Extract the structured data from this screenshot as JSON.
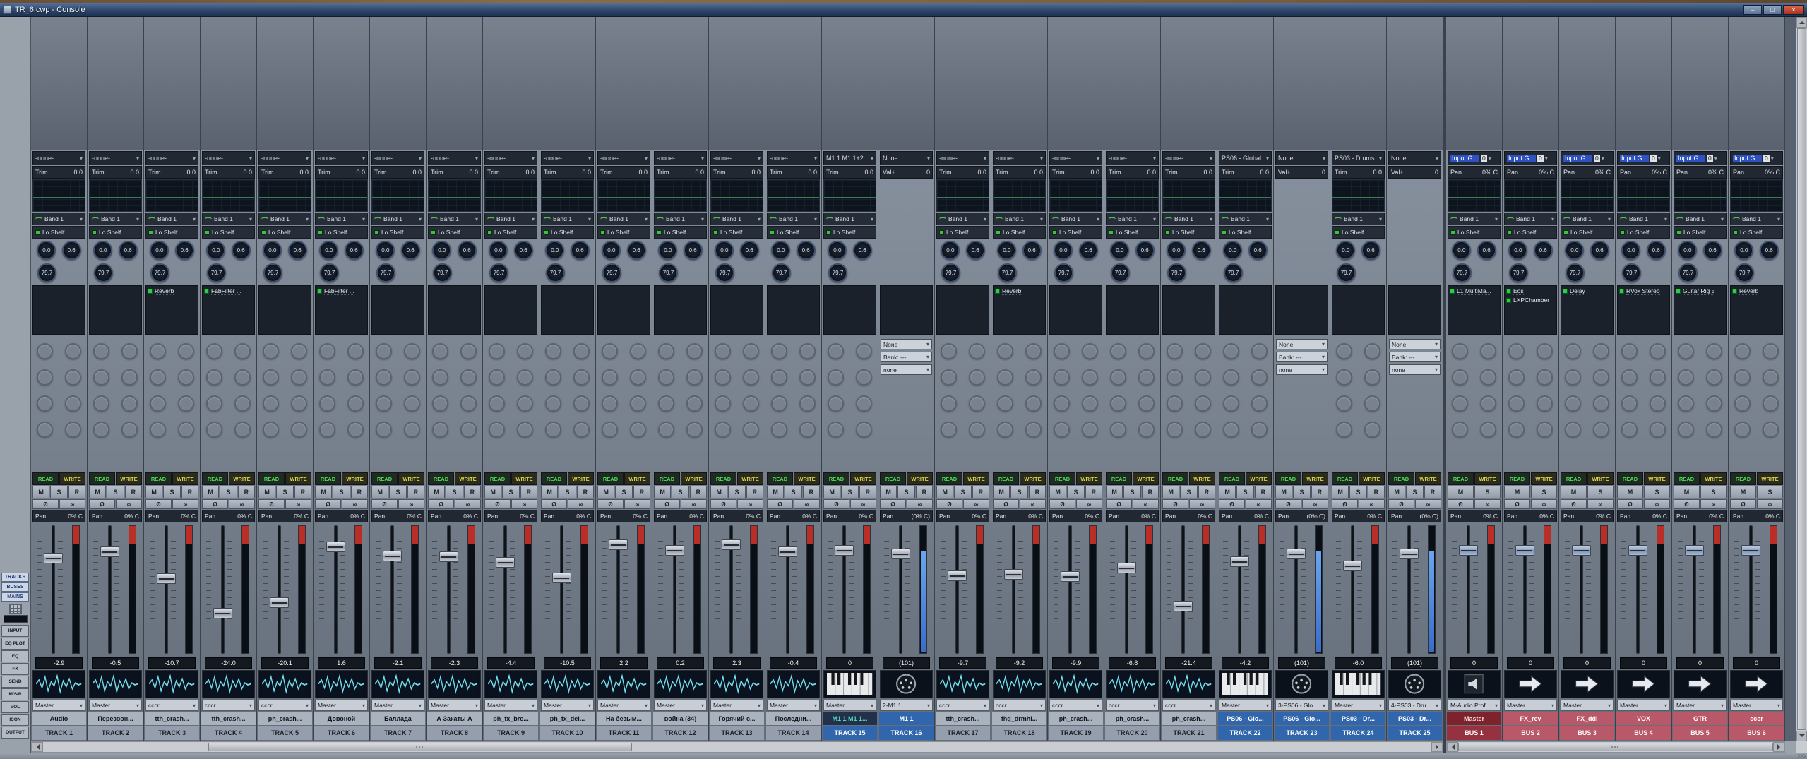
{
  "window": {
    "title": "TR_6.cwp - Console",
    "minimize": "–",
    "maximize": "□",
    "close": "×"
  },
  "glyphs": {
    "dropdown": "▾"
  },
  "left_toolbar": {
    "view_toggles": [
      "TRACKS",
      "BUSES",
      "MAINS"
    ],
    "widget_toggles": [
      "INPUT",
      "EQ PLOT",
      "EQ",
      "FX",
      "SEND",
      "M/S/R",
      "VOL",
      "ICON",
      "OUTPUT"
    ]
  },
  "strip_defaults": {
    "eq": {
      "band": "Band 1",
      "filter": "Lo Shelf",
      "gain": "0.0",
      "q": "0.6",
      "freq": "79.7"
    },
    "automation": {
      "read": "READ",
      "write": "WRITE"
    },
    "track_buttons": [
      "M",
      "S",
      "R"
    ],
    "bus_buttons": [
      "M",
      "S"
    ],
    "misc_buttons": [
      "Ø",
      "∞"
    ]
  },
  "colors": {
    "name_bg": "#aab2be",
    "name_fg": "#12161c",
    "label_bg": "#959eac",
    "label_fg": "#1a1f26",
    "selected_bg": "#3166ac",
    "selected_fg": "#ffffff",
    "meter_clip_red": "#b92f28",
    "midi_meter_blue": "#4a88e0",
    "fx_led_green": "#2fcb4a",
    "read_green": "#4ade52",
    "write_yellow": "#d9d44c"
  },
  "tracks": [
    {
      "name": "Audio",
      "label": "TRACK 1",
      "kind": "audio",
      "icon": "waveform",
      "input": "-none-",
      "gain_label": "Trim",
      "gain_value": "0.0",
      "pan_label": "Pan",
      "pan_value": "0% C",
      "fader": "-2.9",
      "output": "Master",
      "fx": []
    },
    {
      "name": "Перезвон...",
      "label": "TRACK 2",
      "kind": "audio",
      "icon": "waveform",
      "input": "-none-",
      "gain_label": "Trim",
      "gain_value": "0.0",
      "pan_label": "Pan",
      "pan_value": "0% C",
      "fader": "-0.5",
      "output": "Master",
      "fx": []
    },
    {
      "name": "tth_crash...",
      "label": "TRACK 3",
      "kind": "audio",
      "icon": "waveform",
      "input": "-none-",
      "gain_label": "Trim",
      "gain_value": "0.0",
      "pan_label": "Pan",
      "pan_value": "0% C",
      "fader": "-10.7",
      "output": "cccr",
      "fx": [
        "Reverb"
      ]
    },
    {
      "name": "tth_crash...",
      "label": "TRACK 4",
      "kind": "audio",
      "icon": "waveform",
      "input": "-none-",
      "gain_label": "Trim",
      "gain_value": "0.0",
      "pan_label": "Pan",
      "pan_value": "0% C",
      "fader": "-24.0",
      "output": "cccr",
      "fx": [
        "FabFilter ..."
      ]
    },
    {
      "name": "ph_crash...",
      "label": "TRACK 5",
      "kind": "audio",
      "icon": "waveform",
      "input": "-none-",
      "gain_label": "Trim",
      "gain_value": "0.0",
      "pan_label": "Pan",
      "pan_value": "0% C",
      "fader": "-20.1",
      "output": "cccr",
      "fx": []
    },
    {
      "name": "Довоной",
      "label": "TRACK 6",
      "kind": "audio",
      "icon": "waveform",
      "input": "-none-",
      "gain_label": "Trim",
      "gain_value": "0.0",
      "pan_label": "Pan",
      "pan_value": "0% C",
      "fader": "1.6",
      "output": "Master",
      "fx": [
        "FabFilter ..."
      ]
    },
    {
      "name": "Баллада",
      "label": "TRACK 7",
      "kind": "audio",
      "icon": "waveform",
      "input": "-none-",
      "gain_label": "Trim",
      "gain_value": "0.0",
      "pan_label": "Pan",
      "pan_value": "0% C",
      "fader": "-2.1",
      "output": "Master",
      "fx": []
    },
    {
      "name": "А Закаты А",
      "label": "TRACK 8",
      "kind": "audio",
      "icon": "waveform",
      "input": "-none-",
      "gain_label": "Trim",
      "gain_value": "0.0",
      "pan_label": "Pan",
      "pan_value": "0% C",
      "fader": "-2.3",
      "output": "Master",
      "fx": []
    },
    {
      "name": "ph_fx_bre...",
      "label": "TRACK 9",
      "kind": "audio",
      "icon": "waveform",
      "input": "-none-",
      "gain_label": "Trim",
      "gain_value": "0.0",
      "pan_label": "Pan",
      "pan_value": "0% C",
      "fader": "-4.4",
      "output": "Master",
      "fx": []
    },
    {
      "name": "ph_fx_del...",
      "label": "TRACK 10",
      "kind": "audio",
      "icon": "waveform",
      "input": "-none-",
      "gain_label": "Trim",
      "gain_value": "0.0",
      "pan_label": "Pan",
      "pan_value": "0% C",
      "fader": "-10.5",
      "output": "Master",
      "fx": []
    },
    {
      "name": "На безым...",
      "label": "TRACK 11",
      "kind": "audio",
      "icon": "waveform",
      "input": "-none-",
      "gain_label": "Trim",
      "gain_value": "0.0",
      "pan_label": "Pan",
      "pan_value": "0% C",
      "fader": "2.2",
      "output": "Master",
      "fx": []
    },
    {
      "name": "война (34)",
      "label": "TRACK 12",
      "kind": "audio",
      "icon": "waveform",
      "input": "-none-",
      "gain_label": "Trim",
      "gain_value": "0.0",
      "pan_label": "Pan",
      "pan_value": "0% C",
      "fader": "0.2",
      "output": "Master",
      "fx": []
    },
    {
      "name": "Горячий с...",
      "label": "TRACK 13",
      "kind": "audio",
      "icon": "waveform",
      "input": "-none-",
      "gain_label": "Trim",
      "gain_value": "0.0",
      "pan_label": "Pan",
      "pan_value": "0% C",
      "fader": "2.3",
      "output": "Master",
      "fx": []
    },
    {
      "name": "Последни...",
      "label": "TRACK 14",
      "kind": "audio",
      "icon": "waveform",
      "input": "-none-",
      "gain_label": "Trim",
      "gain_value": "0.0",
      "pan_label": "Pan",
      "pan_value": "0% C",
      "fader": "-0.4",
      "output": "Master",
      "fx": []
    },
    {
      "name": "M1 1 M1 1...",
      "label": "TRACK 15",
      "kind": "synth",
      "icon": "keyboard",
      "input": "M1 1 M1 1+2",
      "gain_label": "Trim",
      "gain_value": "0.0",
      "pan_label": "Pan",
      "pan_value": "0% C",
      "fader": "0",
      "output": "Master",
      "fx": [],
      "selected": true,
      "name_bg": "#22304a",
      "name_fg": "#4fd8c4"
    },
    {
      "name": "M1 1",
      "label": "TRACK 16",
      "kind": "midi",
      "icon": "midi-din",
      "input": "None",
      "gain_label": "Val+",
      "gain_value": "0",
      "pan_label": "Pan",
      "pan_value": "(0% C)",
      "fader": "(101)",
      "output": "2-M1 1",
      "fx": [],
      "widgets": [
        "None",
        "Bank: ---",
        "none"
      ],
      "selected": true
    },
    {
      "name": "tth_crash...",
      "label": "TRACK 17",
      "kind": "audio",
      "icon": "waveform",
      "input": "-none-",
      "gain_label": "Trim",
      "gain_value": "0.0",
      "pan_label": "Pan",
      "pan_value": "0% C",
      "fader": "-9.7",
      "output": "cccr",
      "fx": []
    },
    {
      "name": "fhg_drmhi...",
      "label": "TRACK 18",
      "kind": "audio",
      "icon": "waveform",
      "input": "-none-",
      "gain_label": "Trim",
      "gain_value": "0.0",
      "pan_label": "Pan",
      "pan_value": "0% C",
      "fader": "-9.2",
      "output": "cccr",
      "fx": [
        "Reverb"
      ]
    },
    {
      "name": "ph_crash...",
      "label": "TRACK 19",
      "kind": "audio",
      "icon": "waveform",
      "input": "-none-",
      "gain_label": "Trim",
      "gain_value": "0.0",
      "pan_label": "Pan",
      "pan_value": "0% C",
      "fader": "-9.9",
      "output": "cccr",
      "fx": []
    },
    {
      "name": "ph_crash...",
      "label": "TRACK 20",
      "kind": "audio",
      "icon": "waveform",
      "input": "-none-",
      "gain_label": "Trim",
      "gain_value": "0.0",
      "pan_label": "Pan",
      "pan_value": "0% C",
      "fader": "-6.8",
      "output": "cccr",
      "fx": []
    },
    {
      "name": "ph_crash...",
      "label": "TRACK 21",
      "kind": "audio",
      "icon": "waveform",
      "input": "-none-",
      "gain_label": "Trim",
      "gain_value": "0.0",
      "pan_label": "Pan",
      "pan_value": "0% C",
      "fader": "-21.4",
      "output": "cccr",
      "fx": []
    },
    {
      "name": "PS06 - Glo...",
      "label": "TRACK 22",
      "kind": "synth",
      "icon": "keyboard",
      "input": "PS06 - Global",
      "gain_label": "Trim",
      "gain_value": "0.0",
      "pan_label": "Pan",
      "pan_value": "0% C",
      "fader": "-4.2",
      "output": "Master",
      "fx": [],
      "selected": true
    },
    {
      "name": "PS06 - Glo...",
      "label": "TRACK 23",
      "kind": "midi",
      "icon": "midi-din",
      "input": "None",
      "gain_label": "Val+",
      "gain_value": "0",
      "pan_label": "Pan",
      "pan_value": "(0% C)",
      "fader": "(101)",
      "output": "3-PS06 - Glo",
      "fx": [],
      "widgets": [
        "None",
        "Bank: ---",
        "none"
      ],
      "selected": true
    },
    {
      "name": "PS03 - Dr...",
      "label": "TRACK 24",
      "kind": "synth",
      "icon": "keyboard",
      "input": "PS03 - Drums",
      "gain_label": "Trim",
      "gain_value": "0.0",
      "pan_label": "Pan",
      "pan_value": "0% C",
      "fader": "-6.0",
      "output": "Master",
      "fx": [],
      "selected": true
    },
    {
      "name": "PS03 - Dr...",
      "label": "TRACK 25",
      "kind": "midi",
      "icon": "midi-din",
      "input": "None",
      "gain_label": "Val+",
      "gain_value": "0",
      "pan_label": "Pan",
      "pan_value": "(0% C)",
      "fader": "(101)",
      "output": "4-PS03 - Dru",
      "fx": [],
      "widgets": [
        "None",
        "Bank: ---",
        "none"
      ],
      "selected": true
    }
  ],
  "buses": [
    {
      "name": "Master",
      "label": "BUS 1",
      "kind": "bus",
      "icon": "speaker",
      "input": "Input G...",
      "input_value": "0",
      "gain_label": "Pan",
      "gain_value": "0% C",
      "pan_label": "Pan",
      "pan_value": "0% C",
      "fader": "0",
      "output": "M-Audio Prof",
      "fx": [
        "L1 MultiMa..."
      ],
      "name_bg": "#7e222c",
      "name_fg": "#f2d8da",
      "label_bg": "#963240",
      "label_fg": "#ffffff"
    },
    {
      "name": "FX_rev",
      "label": "BUS 2",
      "kind": "bus",
      "icon": "arrow",
      "input": "Input G...",
      "input_value": "0",
      "gain_label": "Pan",
      "gain_value": "0% C",
      "pan_label": "Pan",
      "pan_value": "0% C",
      "fader": "0",
      "output": "Master",
      "fx": [
        "Eos",
        "LXPChamber"
      ],
      "name_bg": "#b85868",
      "name_fg": "#ffffff",
      "label_bg": "#b85868",
      "label_fg": "#ffffff"
    },
    {
      "name": "FX_ddl",
      "label": "BUS 3",
      "kind": "bus",
      "icon": "arrow",
      "input": "Input G...",
      "input_value": "0",
      "gain_label": "Pan",
      "gain_value": "0% C",
      "pan_label": "Pan",
      "pan_value": "0% C",
      "fader": "0",
      "output": "Master",
      "fx": [
        "Delay"
      ],
      "name_bg": "#b85868",
      "name_fg": "#ffffff",
      "label_bg": "#b85868",
      "label_fg": "#ffffff"
    },
    {
      "name": "VOX",
      "label": "BUS 4",
      "kind": "bus",
      "icon": "arrow",
      "input": "Input G...",
      "input_value": "0",
      "gain_label": "Pan",
      "gain_value": "0% C",
      "pan_label": "Pan",
      "pan_value": "0% C",
      "fader": "0",
      "output": "Master",
      "fx": [
        "RVox Stereo"
      ],
      "name_bg": "#b85868",
      "name_fg": "#ffffff",
      "label_bg": "#b85868",
      "label_fg": "#ffffff"
    },
    {
      "name": "GTR",
      "label": "BUS 5",
      "kind": "bus",
      "icon": "arrow",
      "input": "Input G...",
      "input_value": "0",
      "gain_label": "Pan",
      "gain_value": "0% C",
      "pan_label": "Pan",
      "pan_value": "0% C",
      "fader": "0",
      "output": "Master",
      "fx": [
        "Guitar Rig 5"
      ],
      "name_bg": "#b85868",
      "name_fg": "#ffffff",
      "label_bg": "#b85868",
      "label_fg": "#ffffff"
    },
    {
      "name": "cccr",
      "label": "BUS 6",
      "kind": "bus",
      "icon": "arrow",
      "input": "Input G...",
      "input_value": "0",
      "gain_label": "Pan",
      "gain_value": "0% C",
      "pan_label": "Pan",
      "pan_value": "0% C",
      "fader": "0",
      "output": "Master",
      "fx": [
        "Reverb"
      ],
      "name_bg": "#b85868",
      "name_fg": "#ffffff",
      "label_bg": "#b85868",
      "label_fg": "#ffffff"
    }
  ]
}
